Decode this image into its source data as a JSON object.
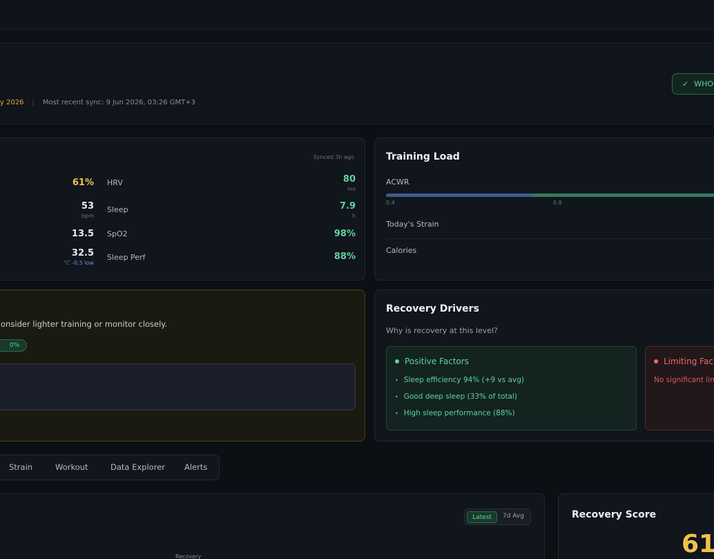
{
  "header": {
    "sync_date_fragment": "y 2026",
    "sync_separator": "|",
    "recent_sync": "Most recent sync: 9 Jun 2026, 03:26 GMT+3",
    "whoop_button": "WHOO",
    "whoop_icon": "check-icon"
  },
  "metrics": {
    "synced": "Synced 3h ago",
    "rows": [
      {
        "left_value": "61%",
        "left_unit": "",
        "name": "HRV",
        "right_value": "80",
        "right_unit": "ms"
      },
      {
        "left_value": "53",
        "left_unit": "bpm",
        "name": "Sleep",
        "right_value": "7.9",
        "right_unit": "h"
      },
      {
        "left_value": "13.5",
        "left_unit": "",
        "name": "SpO2",
        "right_value": "98%",
        "right_unit": ""
      },
      {
        "left_value": "32.5",
        "left_unit": "°C",
        "left_delta": "-0.5 low",
        "name": "Sleep Perf",
        "right_value": "88%",
        "right_unit": ""
      }
    ]
  },
  "training_load": {
    "title": "Training Load",
    "acwr_label": "ACWR",
    "ticks": [
      "0.4",
      "0.8"
    ],
    "strain_label": "Today's Strain",
    "calories_label": "Calories",
    "colors": {
      "low": "#3d5a8f",
      "optimal": "#2e7a5e"
    }
  },
  "alert": {
    "message": "onsider lighter training or monitor closely.",
    "pill": "0%"
  },
  "drivers": {
    "title": "Recovery Drivers",
    "subtitle": "Why is recovery at this level?",
    "positive_title": "Positive Factors",
    "positive_items": [
      "Sleep efficiency 94% (+9 vs avg)",
      "Good deep sleep (33% of total)",
      "High sleep performance (88%)"
    ],
    "limiting_title": "Limiting Fac",
    "limiting_item": "No significant lin"
  },
  "tabs": [
    "Strain",
    "Workout",
    "Data Explorer",
    "Alerts"
  ],
  "bottom": {
    "toggle_active": "Latest",
    "toggle_inactive": "7d Avg",
    "recovery_label": "Recovery",
    "recovery_score_title": "Recovery Score",
    "recovery_score_value": "61"
  }
}
